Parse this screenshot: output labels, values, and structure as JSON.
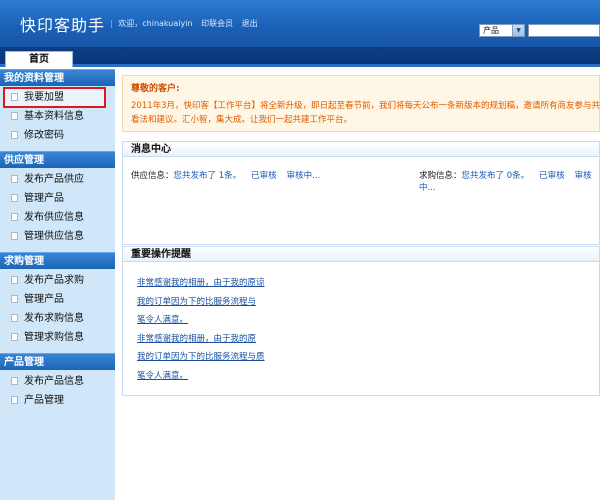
{
  "header": {
    "logo": "快印客助手",
    "welcome": "欢迎，chinakuaiyin",
    "member": "印联会员",
    "logout": "退出",
    "search_select_value": "产品"
  },
  "nav": {
    "home": "首页"
  },
  "sidebar": {
    "groups": [
      {
        "title": "我的资料管理",
        "items": [
          "我要加盟",
          "基本资料信息",
          "修改密码"
        ]
      },
      {
        "title": "供应管理",
        "items": [
          "发布产品供应",
          "管理产品",
          "发布供应信息",
          "管理供应信息"
        ]
      },
      {
        "title": "求购管理",
        "items": [
          "发布产品求购",
          "管理产品",
          "发布求购信息",
          "管理求购信息"
        ]
      },
      {
        "title": "产品管理",
        "items": [
          "发布产品信息",
          "产品管理"
        ]
      }
    ]
  },
  "welcome": {
    "greeting": "尊敬的客户:",
    "line1": "2011年3月，快印客【工作平台】将全新升级，即日起至春节前，我们将每天公布一条新版本的规划稿，邀请所有商友参与共",
    "line2": "看法和建议。汇小智，集大成。让我们一起共建工作平台。"
  },
  "message_center": {
    "title": "消息中心",
    "supply": {
      "label": "供应信息：",
      "published": "您共发布了 1条。",
      "approved": "已审核",
      "reviewing": "审核中..."
    },
    "purchase": {
      "label": "求购信息：",
      "published": "您共发布了 0条。",
      "approved": "已审核",
      "reviewing": "审核中..."
    }
  },
  "important_ops": {
    "title": "重要操作提醒",
    "items": [
      "非常感谢我的相册，由于我的原谅",
      "我的订单因为下的比服务流程与",
      "笔令人满意。",
      "非常感谢我的相册，由于我的原",
      "我的订单因为下的比服务流程与质",
      "笔令人满意。"
    ]
  },
  "colors": {
    "header_blue": "#1a5fb5",
    "nav_dark": "#0a3577",
    "sidebar_bg": "#cfe7f9",
    "highlight_border": "#e01818",
    "welcome_text": "#e05a00",
    "link": "#1a57b3"
  }
}
